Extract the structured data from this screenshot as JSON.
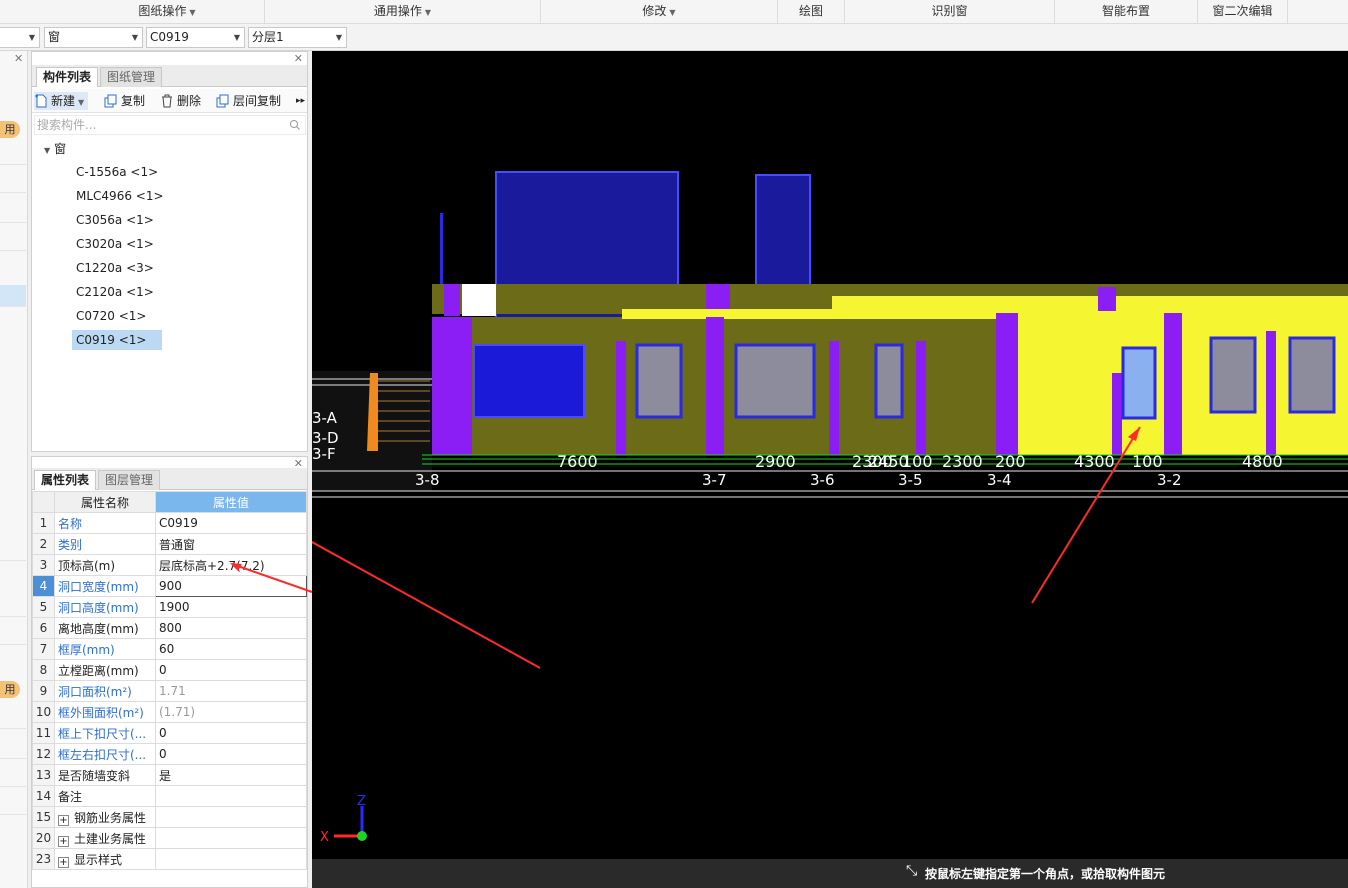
{
  "ribbon": {
    "groups": [
      "图纸操作",
      "通用操作",
      "修改",
      "绘图",
      "识别窗",
      "智能布置",
      "窗二次编辑"
    ]
  },
  "selectors": {
    "type": "窗",
    "component": "C0919",
    "layer": "分层1"
  },
  "left_strip": {
    "badge": "用"
  },
  "component_panel": {
    "tabs": [
      "构件列表",
      "图纸管理"
    ],
    "toolbar": {
      "new": "新建",
      "copy": "复制",
      "delete": "删除",
      "floor_copy": "层间复制"
    },
    "search_placeholder": "搜索构件...",
    "tree_root": "窗",
    "items": [
      "C-1556a <1>",
      "MLC4966 <1>",
      "C3056a <1>",
      "C3020a <1>",
      "C1220a <3>",
      "C2120a <1>",
      "C0720 <1>",
      "C0919 <1>"
    ],
    "selected_index": 7
  },
  "property_panel": {
    "tabs": [
      "属性列表",
      "图层管理"
    ],
    "col_name": "属性名称",
    "col_value": "属性值",
    "rows": [
      {
        "idx": "1",
        "name": "名称",
        "value": "C0919",
        "blue": true
      },
      {
        "idx": "2",
        "name": "类别",
        "value": "普通窗",
        "blue": true
      },
      {
        "idx": "3",
        "name": "顶标高(m)",
        "value": "层底标高+2.7(7.2)",
        "blue": false
      },
      {
        "idx": "4",
        "name": "洞口宽度(mm)",
        "value": "900",
        "blue": true
      },
      {
        "idx": "5",
        "name": "洞口高度(mm)",
        "value": "1900",
        "blue": true
      },
      {
        "idx": "6",
        "name": "离地高度(mm)",
        "value": "800",
        "blue": false
      },
      {
        "idx": "7",
        "name": "框厚(mm)",
        "value": "60",
        "blue": true
      },
      {
        "idx": "8",
        "name": "立樘距离(mm)",
        "value": "0",
        "blue": false
      },
      {
        "idx": "9",
        "name": "洞口面积(m²)",
        "value": "1.71",
        "blue": true
      },
      {
        "idx": "10",
        "name": "框外围面积(m²)",
        "value": "(1.71)",
        "blue": true
      },
      {
        "idx": "11",
        "name": "框上下扣尺寸(...",
        "value": "0",
        "blue": true
      },
      {
        "idx": "12",
        "name": "框左右扣尺寸(...",
        "value": "0",
        "blue": true
      },
      {
        "idx": "13",
        "name": "是否随墙变斜",
        "value": "是",
        "blue": false
      },
      {
        "idx": "14",
        "name": "备注",
        "value": "",
        "blue": false
      },
      {
        "idx": "15",
        "name": "钢筋业务属性",
        "value": "",
        "blue": false,
        "group": true
      },
      {
        "idx": "20",
        "name": "土建业务属性",
        "value": "",
        "blue": false,
        "group": true
      },
      {
        "idx": "23",
        "name": "显示样式",
        "value": "",
        "blue": false,
        "group": true
      }
    ],
    "active_row": "4"
  },
  "viewport": {
    "dimension_labels": [
      "7600",
      "2900",
      "2300",
      "2450",
      "100",
      "2300",
      "200",
      "4300",
      "100",
      "4800"
    ],
    "axis_labels": [
      "3-8",
      "3-7",
      "3-6",
      "3-5",
      "3-4",
      "3-2",
      "3-A",
      "3-D",
      "3-F"
    ],
    "coord_labels": {
      "z": "Z",
      "x": "X"
    }
  },
  "status": {
    "message": "按鼠标左键指定第一个角点，或拾取构件图元"
  }
}
